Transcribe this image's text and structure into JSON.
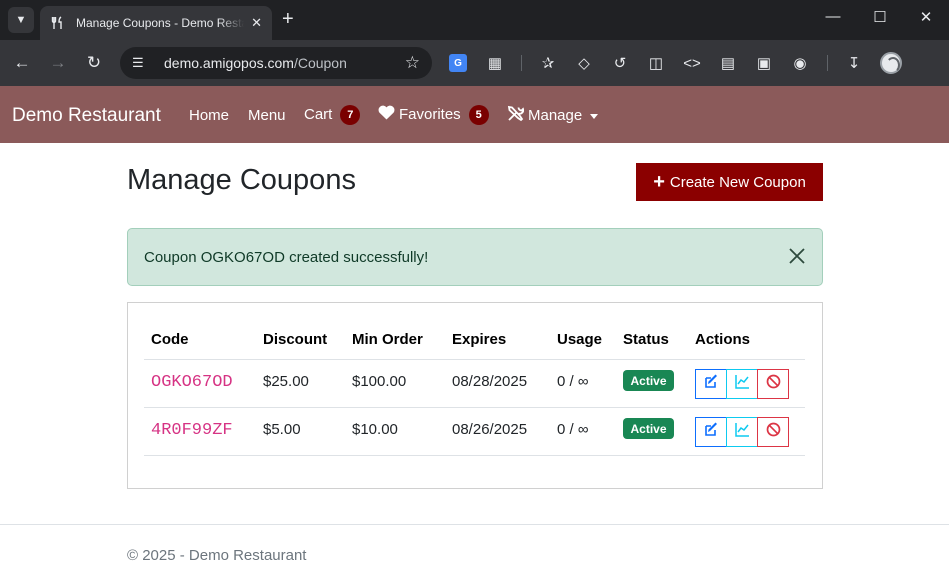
{
  "browser": {
    "tab_title": "Manage Coupons - Demo Restaurant",
    "url_host": "demo.amigopos.com",
    "url_path": "/Coupon"
  },
  "navbar": {
    "brand": "Demo Restaurant",
    "home": "Home",
    "menu": "Menu",
    "cart": "Cart",
    "cart_count": "7",
    "favorites": "Favorites",
    "favorites_count": "5",
    "manage": "Manage",
    "bg_color": "#8b5a5a",
    "badge_color": "#7a0000"
  },
  "page": {
    "title": "Manage Coupons",
    "create_button": "Create New Coupon",
    "create_color": "#8b0000"
  },
  "alert": {
    "message": "Coupon OGKO67OD created successfully!"
  },
  "table": {
    "headers": [
      "Code",
      "Discount",
      "Min Order",
      "Expires",
      "Usage",
      "Status",
      "Actions"
    ],
    "rows": [
      {
        "code": "OGKO67OD",
        "discount": "$25.00",
        "min_order": "$100.00",
        "expires": "08/28/2025",
        "usage": "0 / ∞",
        "status": "Active"
      },
      {
        "code": "4R0F99ZF",
        "discount": "$5.00",
        "min_order": "$10.00",
        "expires": "08/26/2025",
        "usage": "0 / ∞",
        "status": "Active"
      }
    ],
    "status_color": "#198754"
  },
  "footer": {
    "text": "© 2025 - Demo Restaurant"
  }
}
